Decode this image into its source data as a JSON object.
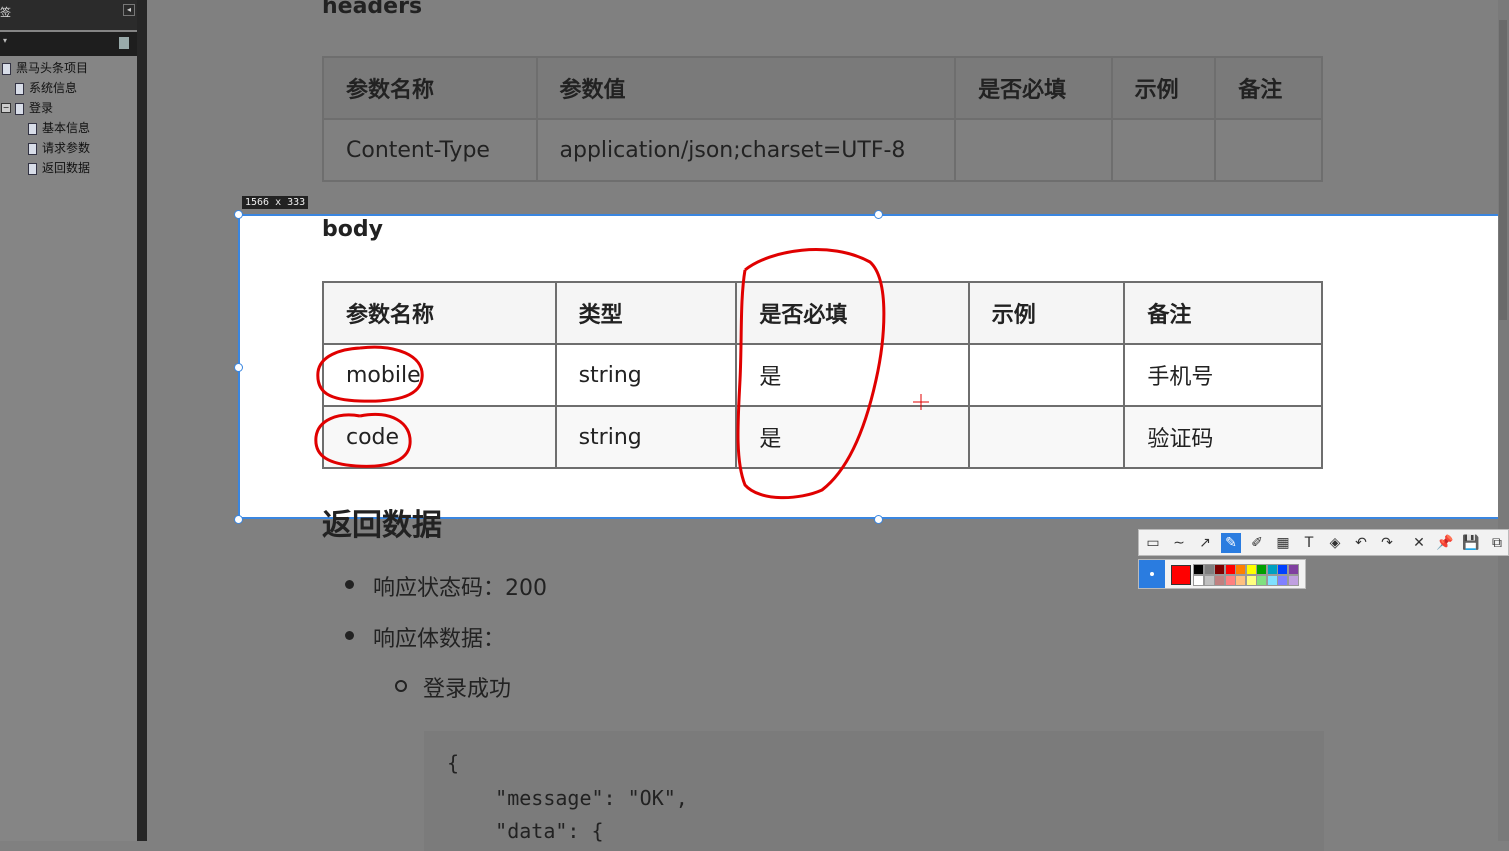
{
  "sidebar": {
    "top_label": "签",
    "tree": [
      {
        "label": "黑马头条项目",
        "level": 0
      },
      {
        "label": "系统信息",
        "level": 1
      },
      {
        "label": "登录",
        "level": 1,
        "expanded": true
      },
      {
        "label": "基本信息",
        "level": 2
      },
      {
        "label": "请求参数",
        "level": 2
      },
      {
        "label": "返回数据",
        "level": 2
      }
    ],
    "expand_icon": "−"
  },
  "doc": {
    "headers_title": "headers",
    "headers_table": {
      "columns": [
        "参数名称",
        "参数值",
        "是否必填",
        "示例",
        "备注"
      ],
      "rows": [
        [
          "Content-Type",
          "application/json;charset=UTF-8",
          "",
          "",
          ""
        ]
      ]
    },
    "body_title": "body",
    "body_table": {
      "columns": [
        "参数名称",
        "类型",
        "是否必填",
        "示例",
        "备注"
      ],
      "rows": [
        [
          "mobile",
          "string",
          "是",
          "",
          "手机号"
        ],
        [
          "code",
          "string",
          "是",
          "",
          "验证码"
        ]
      ]
    },
    "return_title": "返回数据",
    "bullets": [
      "响应状态码：200",
      "响应体数据："
    ],
    "sub_bullets": [
      "登录成功"
    ],
    "code_lines": [
      "{",
      "    \"message\": \"OK\",",
      "    \"data\": {"
    ]
  },
  "screenshot_tool": {
    "size_label": "1566 x 333",
    "toolbar_icons": [
      "rect-icon",
      "curve-icon",
      "arrow-icon",
      "pen-icon",
      "marker-icon",
      "mosaic-icon",
      "text-icon",
      "eraser-icon",
      "undo-icon",
      "redo-icon",
      "close-icon",
      "pin-icon",
      "save-icon",
      "copy-icon"
    ],
    "toolbar_glyphs": [
      "▭",
      "∼",
      "↗",
      "✎",
      "✐",
      "▦",
      "T",
      "◈",
      "↶",
      "↷",
      "✕",
      "📌",
      "💾",
      "⧉"
    ],
    "active_tool_index": 3,
    "current_color": "#ff0000",
    "palette_colors": [
      "#000000",
      "#808080",
      "#800000",
      "#ff0000",
      "#ff8000",
      "#ffff00",
      "#00a000",
      "#00a0c0",
      "#0040ff",
      "#8040a0",
      "#ffffff",
      "#c0c0c0",
      "#c08080",
      "#ff8080",
      "#ffc080",
      "#ffff80",
      "#80e080",
      "#80e0ff",
      "#8080ff",
      "#c0a0e0"
    ],
    "annotation_color": "#e00000"
  }
}
